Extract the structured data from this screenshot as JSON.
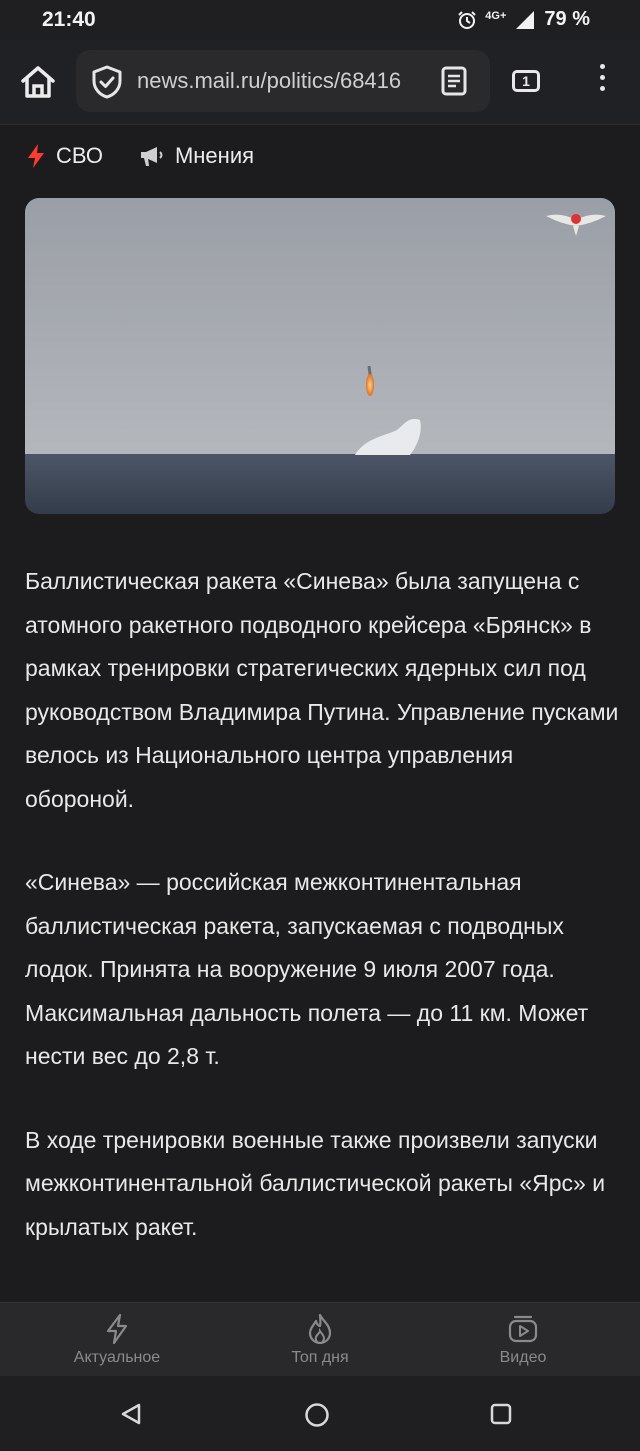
{
  "status_bar": {
    "time": "21:40",
    "network": "4G",
    "network_plus": "+",
    "battery": "79 %"
  },
  "browser": {
    "url": "news.mail.ru/politics/68416",
    "tab_count": "1",
    "icons": [
      "home-icon",
      "shield-check-icon",
      "reader-mode-icon",
      "tabs-icon",
      "more-vert-icon"
    ]
  },
  "nav": {
    "items": [
      {
        "label": "СВО",
        "icon": "lightning-icon",
        "icon_color": "#ff3b30"
      },
      {
        "label": "Мнения",
        "icon": "megaphone-icon"
      }
    ]
  },
  "article": {
    "paragraphs": [
      "Баллистическая ракета «Синева» была запущена с атомного ракетного подводного крейсера «Брянск» в рамках тренировки стратегических ядерных сил под руководством Владимира Путина. Управление пусками велось из Национального центра управления обороной.",
      "«Синева» — российская межконтинентальная баллистическая ракета, запускаемая с подводных лодок. Принята на вооружение 9 июля 2007 года. Максимальная дальность полета — до 11 км. Может нести вес до 2,8 т.",
      "В ходе тренировки военные также произвели запуски межконтинентальной баллистической ракеты «Ярс» и крылатых ракет."
    ]
  },
  "bottom_tabs": [
    {
      "label": "Актуальное",
      "icon": "lightning-outline-icon"
    },
    {
      "label": "Топ дня",
      "icon": "flame-icon"
    },
    {
      "label": "Видео",
      "icon": "video-play-icon"
    }
  ],
  "system_nav": [
    "back-icon",
    "home-circle-icon",
    "recents-icon"
  ],
  "colors": {
    "background": "#1c1c1e",
    "accent_red": "#ff3b30",
    "inactive_tab": "#8a8a8d"
  }
}
